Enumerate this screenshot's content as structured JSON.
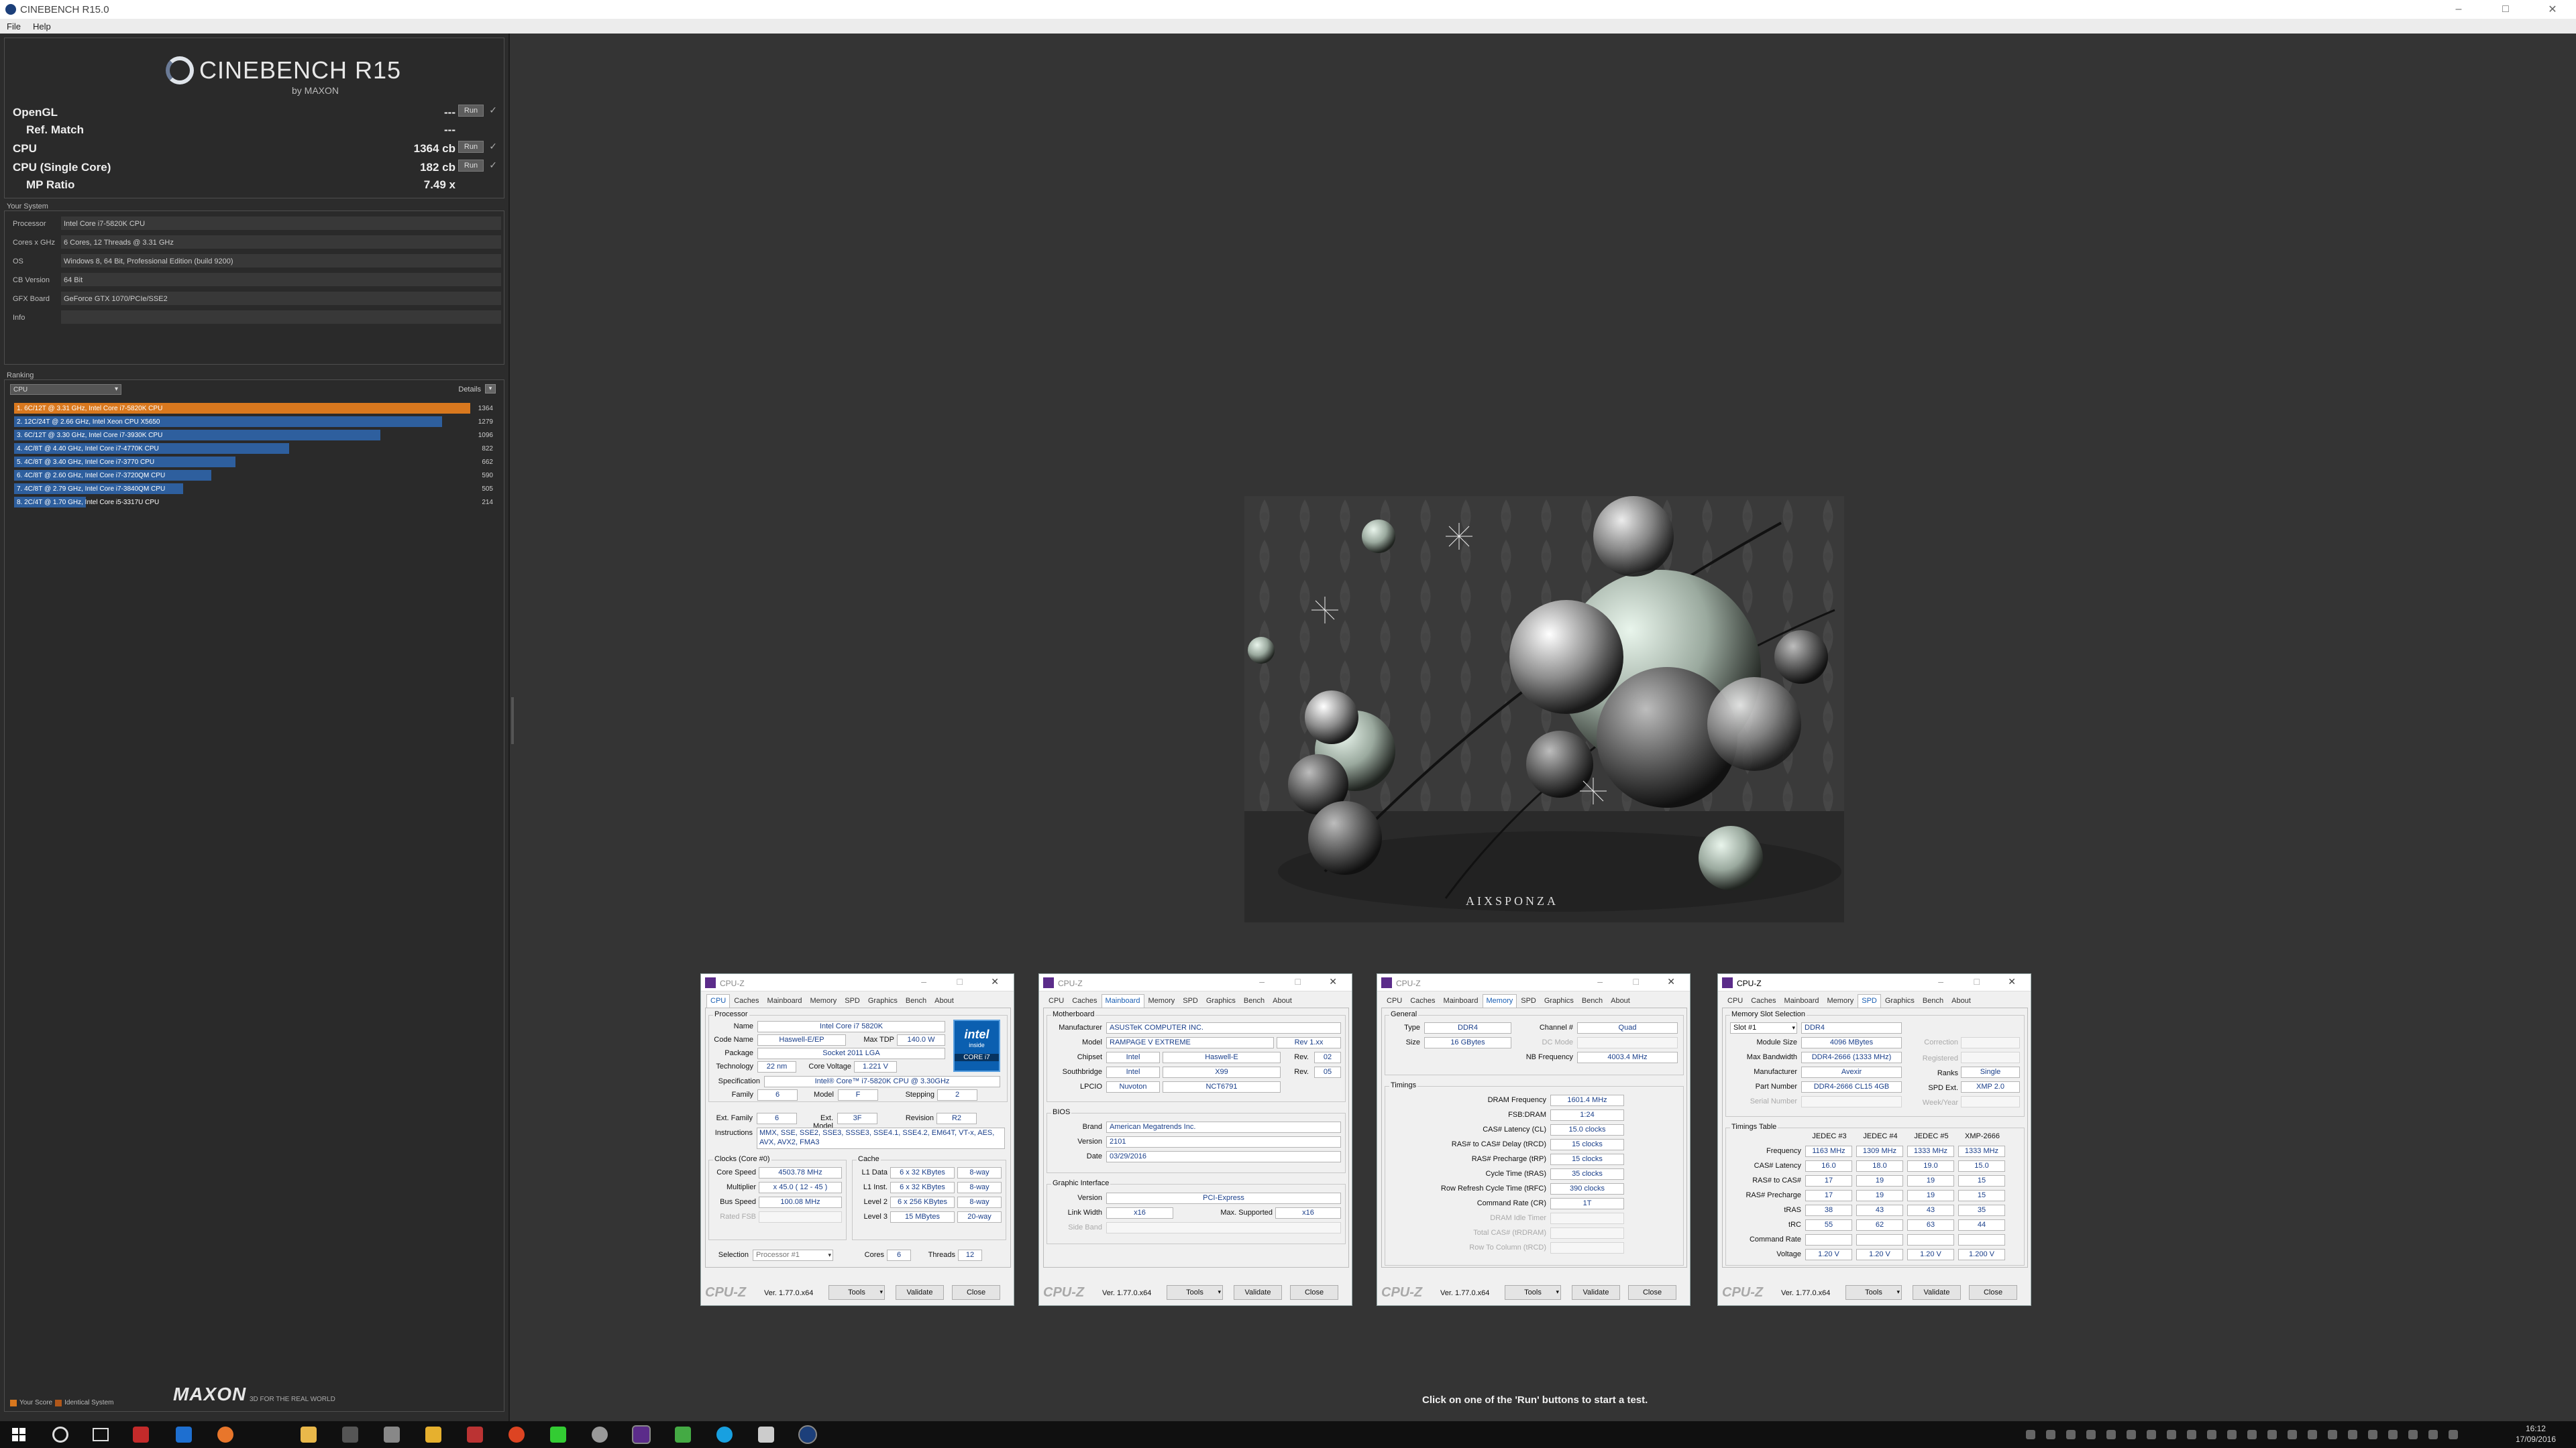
{
  "window": {
    "title": "CINEBENCH R15.0"
  },
  "menu": [
    "File",
    "Help"
  ],
  "logo": {
    "name": "CINEBENCH R15",
    "by": "by MAXON"
  },
  "scores": [
    {
      "label": "OpenGL",
      "value": "---",
      "button": "Run",
      "check": "✓"
    },
    {
      "label": "Ref. Match",
      "value": "---"
    },
    {
      "label": "CPU",
      "value": "1364 cb",
      "button": "Run",
      "check": "✓"
    },
    {
      "label": "CPU (Single Core)",
      "value": "182 cb",
      "button": "Run",
      "check": "✓"
    },
    {
      "label": "MP Ratio",
      "value": "7.49 x"
    }
  ],
  "system": {
    "title": "Your System",
    "rows": [
      {
        "key": "Processor",
        "value": "Intel Core i7-5820K CPU"
      },
      {
        "key": "Cores x GHz",
        "value": "6 Cores, 12 Threads @ 3.31 GHz"
      },
      {
        "key": "OS",
        "value": "Windows 8, 64 Bit, Professional Edition (build 9200)"
      },
      {
        "key": "CB Version",
        "value": "64 Bit"
      },
      {
        "key": "GFX Board",
        "value": "GeForce GTX 1070/PCIe/SSE2"
      },
      {
        "key": "Info",
        "value": ""
      }
    ]
  },
  "ranking": {
    "title": "Ranking",
    "dropdown": "CPU",
    "details_label": "Details",
    "max": 1364,
    "items": [
      {
        "label": "1. 6C/12T @ 3.31 GHz, Intel Core i7-5820K CPU",
        "score": 1364,
        "highlight": true,
        "color": "#d9781e"
      },
      {
        "label": "2. 12C/24T @ 2.66 GHz, Intel Xeon CPU X5650",
        "score": 1279,
        "color": "#2e5f9e"
      },
      {
        "label": "3. 6C/12T @ 3.30 GHz,  Intel Core i7-3930K CPU",
        "score": 1096,
        "color": "#2e5f9e"
      },
      {
        "label": "4. 4C/8T @ 4.40 GHz, Intel Core i7-4770K CPU",
        "score": 822,
        "color": "#2e5f9e"
      },
      {
        "label": "5. 4C/8T @ 3.40 GHz,  Intel Core i7-3770 CPU",
        "score": 662,
        "color": "#2e5f9e"
      },
      {
        "label": "6. 4C/8T @ 2.60 GHz, Intel Core i7-3720QM CPU",
        "score": 590,
        "color": "#2e5f9e"
      },
      {
        "label": "7. 4C/8T @ 2.79 GHz,  Intel Core i7-3840QM CPU",
        "score": 505,
        "color": "#2e5f9e"
      },
      {
        "label": "8. 2C/4T @ 1.70 GHz,  Intel Core i5-3317U CPU",
        "score": 214,
        "color": "#2e5f9e"
      }
    ]
  },
  "legend": {
    "your_score": "Your Score",
    "identical": "Identical System",
    "your_color": "#d9781e",
    "identical_color": "#b0571a"
  },
  "footer": {
    "brand": "MAXON",
    "tagline": "3D FOR THE REAL WORLD"
  },
  "status": "Click on one of the 'Run' buttons to start a test.",
  "render": {
    "watermark": "AIXSPONZA"
  },
  "cpuz_common": {
    "title": "CPU-Z",
    "logo": "CPU-Z",
    "version": "Ver. 1.77.0.x64",
    "tools": "Tools",
    "validate": "Validate",
    "close": "Close",
    "tabs": [
      "CPU",
      "Caches",
      "Mainboard",
      "Memory",
      "SPD",
      "Graphics",
      "Bench",
      "About"
    ]
  },
  "cpuz_cpu": {
    "processor": "Processor",
    "name_l": "Name",
    "name": "Intel Core i7 5820K",
    "codename_l": "Code Name",
    "codename": "Haswell-E/EP",
    "tdp_l": "Max TDP",
    "tdp": "140.0 W",
    "package_l": "Package",
    "package": "Socket 2011 LGA",
    "tech_l": "Technology",
    "tech": "22 nm",
    "cv_l": "Core Voltage",
    "cv": "1.221 V",
    "spec_l": "Specification",
    "spec": "Intel® Core™ i7-5820K CPU @ 3.30GHz",
    "family_l": "Family",
    "family": "6",
    "model_l": "Model",
    "model": "F",
    "stepping_l": "Stepping",
    "stepping": "2",
    "extfam_l": "Ext. Family",
    "extfam": "6",
    "extmod_l": "Ext. Model",
    "extmod": "3F",
    "rev_l": "Revision",
    "rev": "R2",
    "instr_l": "Instructions",
    "instr": "MMX, SSE, SSE2, SSE3, SSSE3, SSE4.1, SSE4.2, EM64T, VT-x, AES, AVX, AVX2, FMA3",
    "clocks": "Clocks (Core #0)",
    "speed_l": "Core Speed",
    "speed": "4503.78 MHz",
    "mult_l": "Multiplier",
    "mult": "x 45.0 ( 12 - 45 )",
    "bus_l": "Bus Speed",
    "bus": "100.08 MHz",
    "fsb_l": "Rated FSB",
    "cache": "Cache",
    "l1d_l": "L1 Data",
    "l1d": "6 x 32 KBytes",
    "l1d_w": "8-way",
    "l1i_l": "L1 Inst.",
    "l1i": "6 x 32 KBytes",
    "l1i_w": "8-way",
    "l2_l": "Level 2",
    "l2": "6 x 256 KBytes",
    "l2_w": "8-way",
    "l3_l": "Level 3",
    "l3": "15 MBytes",
    "l3_w": "20-way",
    "sel_l": "Selection",
    "sel": "Processor #1",
    "cores_l": "Cores",
    "cores": "6",
    "threads_l": "Threads",
    "threads": "12",
    "intel_logo": "intel",
    "intel_sub": "inside",
    "intel_core": "CORE i7"
  },
  "cpuz_mb": {
    "mb": "Motherboard",
    "manuf_l": "Manufacturer",
    "manuf": "ASUSTeK COMPUTER INC.",
    "model_l": "Model",
    "model": "RAMPAGE V EXTREME",
    "model_rev": "Rev 1.xx",
    "chipset_l": "Chipset",
    "chipset_v": "Intel",
    "chipset": "Haswell-E",
    "rev_l": "Rev.",
    "chipset_rev": "02",
    "south_l": "Southbridge",
    "south_v": "Intel",
    "south": "X99",
    "south_rev": "05",
    "lpc_l": "LPCIO",
    "lpc_v": "Nuvoton",
    "lpc": "NCT6791",
    "bios": "BIOS",
    "brand_l": "Brand",
    "brand": "American Megatrends Inc.",
    "ver_l": "Version",
    "ver": "2101",
    "date_l": "Date",
    "date": "03/29/2016",
    "gi": "Graphic Interface",
    "giver_l": "Version",
    "giver": "PCI-Express",
    "lw_l": "Link Width",
    "lw": "x16",
    "ms_l": "Max. Supported",
    "ms": "x16",
    "sb_l": "Side Band"
  },
  "cpuz_mem": {
    "general": "General",
    "type_l": "Type",
    "type": "DDR4",
    "chan_l": "Channel #",
    "chan": "Quad",
    "size_l": "Size",
    "size": "16 GBytes",
    "dc_l": "DC Mode",
    "nb_l": "NB Frequency",
    "nb": "4003.4 MHz",
    "timings": "Timings",
    "rows": [
      {
        "l": "DRAM Frequency",
        "v": "1601.4 MHz"
      },
      {
        "l": "FSB:DRAM",
        "v": "1:24"
      },
      {
        "l": "CAS# Latency (CL)",
        "v": "15.0 clocks"
      },
      {
        "l": "RAS# to CAS# Delay (tRCD)",
        "v": "15 clocks"
      },
      {
        "l": "RAS# Precharge (tRP)",
        "v": "15 clocks"
      },
      {
        "l": "Cycle Time (tRAS)",
        "v": "35 clocks"
      },
      {
        "l": "Row Refresh Cycle Time (tRFC)",
        "v": "390 clocks"
      },
      {
        "l": "Command Rate (CR)",
        "v": "1T"
      },
      {
        "l": "DRAM Idle Timer",
        "v": "",
        "dim": true
      },
      {
        "l": "Total CAS# (tRDRAM)",
        "v": "",
        "dim": true
      },
      {
        "l": "Row To Column (tRCD)",
        "v": "",
        "dim": true
      }
    ]
  },
  "cpuz_spd": {
    "mss": "Memory Slot Selection",
    "slot": "Slot #1",
    "slot_type": "DDR4",
    "modsize_l": "Module Size",
    "modsize": "4096 MBytes",
    "corr_l": "Correction",
    "maxbw_l": "Max Bandwidth",
    "maxbw": "DDR4-2666 (1333 MHz)",
    "reg_l": "Registered",
    "manuf_l": "Manufacturer",
    "manuf": "Avexir",
    "ranks_l": "Ranks",
    "ranks": "Single",
    "part_l": "Part Number",
    "part": "DDR4-2666 CL15 4GB",
    "spdext_l": "SPD Ext.",
    "spdext": "XMP 2.0",
    "serial_l": "Serial Number",
    "week_l": "Week/Year",
    "tt": "Timings Table",
    "cols": [
      "JEDEC #3",
      "JEDEC #4",
      "JEDEC #5",
      "XMP-2666"
    ],
    "rows": [
      {
        "l": "Frequency",
        "v": [
          "1163 MHz",
          "1309 MHz",
          "1333 MHz",
          "1333 MHz"
        ]
      },
      {
        "l": "CAS# Latency",
        "v": [
          "16.0",
          "18.0",
          "19.0",
          "15.0"
        ]
      },
      {
        "l": "RAS# to CAS#",
        "v": [
          "17",
          "19",
          "19",
          "15"
        ]
      },
      {
        "l": "RAS# Precharge",
        "v": [
          "17",
          "19",
          "19",
          "15"
        ]
      },
      {
        "l": "tRAS",
        "v": [
          "38",
          "43",
          "43",
          "35"
        ]
      },
      {
        "l": "tRC",
        "v": [
          "55",
          "62",
          "63",
          "44"
        ]
      },
      {
        "l": "Command Rate",
        "v": [
          "",
          "",
          "",
          ""
        ]
      },
      {
        "l": "Voltage",
        "v": [
          "1.20 V",
          "1.20 V",
          "1.20 V",
          "1.200 V"
        ]
      }
    ]
  },
  "clock": {
    "time": "16:12",
    "date": "17/09/2016"
  }
}
